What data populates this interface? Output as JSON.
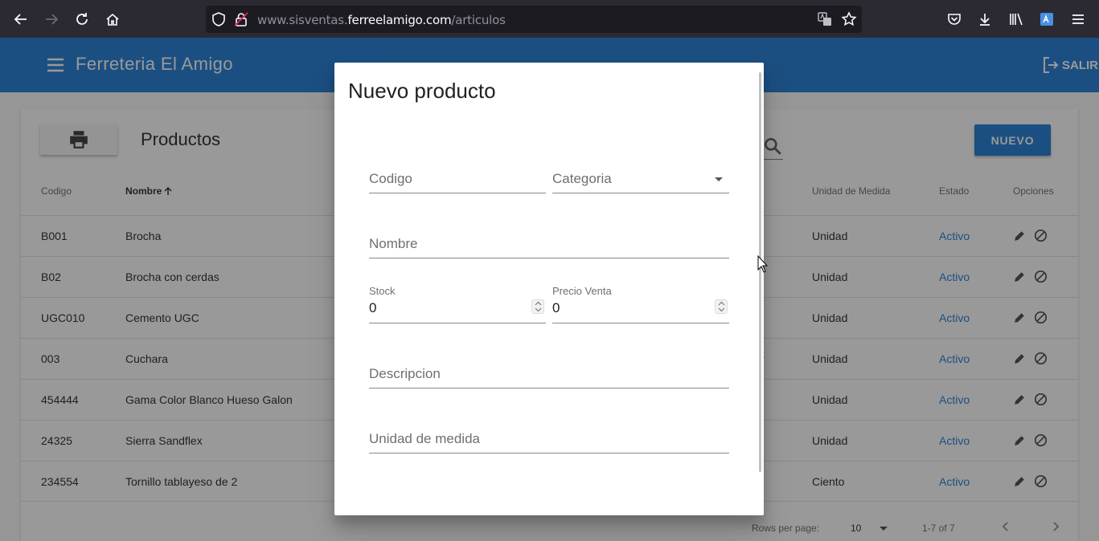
{
  "browser": {
    "url_prefix": "www.sisventas.",
    "url_domain": "ferreelamigo.com",
    "url_path": "/articulos"
  },
  "app": {
    "title": "Ferreteria El Amigo",
    "logout_label": "SALIR"
  },
  "page": {
    "title": "Productos",
    "new_button": "NUEVO"
  },
  "table": {
    "headers": {
      "codigo": "Codigo",
      "nombre": "Nombre",
      "unidad": "Unidad de Medida",
      "estado": "Estado",
      "opciones": "Opciones"
    },
    "rows": [
      {
        "codigo": "B001",
        "nombre": "Brocha",
        "unidad": "Unidad",
        "estado": "Activo"
      },
      {
        "codigo": "B02",
        "nombre": "Brocha con cerdas",
        "unidad": "Unidad",
        "estado": "Activo"
      },
      {
        "codigo": "UGC010",
        "nombre": "Cemento UGC",
        "unidad": "Unidad",
        "estado": "Activo"
      },
      {
        "codigo": "003",
        "nombre": "Cuchara",
        "unidad": "Unidad",
        "estado": "Activo"
      },
      {
        "codigo": "454444",
        "nombre": "Gama Color Blanco Hueso Galon",
        "unidad": "Unidad",
        "estado": "Activo"
      },
      {
        "codigo": "24325",
        "nombre": "Sierra Sandflex",
        "unidad": "Unidad",
        "estado": "Activo"
      },
      {
        "codigo": "234554",
        "nombre": "Tornillo tablayeso de 2",
        "unidad": "Ciento",
        "estado": "Activo"
      }
    ],
    "partial_text": "r"
  },
  "pagination": {
    "rows_per_page_label": "Rows per page:",
    "rows_per_page_value": "10",
    "range": "1-7 of 7"
  },
  "dialog": {
    "title": "Nuevo producto",
    "codigo_placeholder": "Codigo",
    "categoria_placeholder": "Categoria",
    "nombre_placeholder": "Nombre",
    "stock_label": "Stock",
    "stock_value": "0",
    "precio_label": "Precio Venta",
    "precio_value": "0",
    "descripcion_placeholder": "Descripcion",
    "unidad_placeholder": "Unidad de medida"
  },
  "colors": {
    "primary": "#1976d2",
    "browser_bg": "#2b2a33"
  }
}
